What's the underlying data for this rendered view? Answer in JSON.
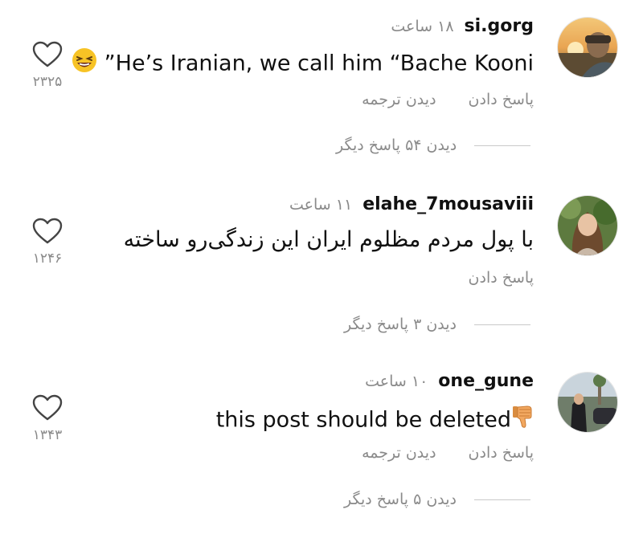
{
  "comments": [
    {
      "username": "si.gorg",
      "time": "۱۸ ساعت",
      "text_main": "”He’s Iranian, we call him “Bache Kooni",
      "emoji": "laughing-face",
      "actions": [
        "پاسخ دادن",
        "دیدن ترجمه"
      ],
      "view_replies": "دیدن ۵۴ پاسخ دیگر",
      "likes": "۲۳۲۵"
    },
    {
      "username": "elahe_7mousaviii",
      "time": "۱۱ ساعت",
      "text_main": "با پول مردم مظلوم ایران این زندگی‌رو ساخته",
      "actions": [
        "پاسخ دادن"
      ],
      "view_replies": "دیدن ۳ پاسخ دیگر",
      "likes": "۱۲۴۶"
    },
    {
      "username": "one_gune",
      "time": "۱۰ ساعت",
      "text_main": "this post should be deleted",
      "emoji": "thumbs-down",
      "actions": [
        "پاسخ دادن",
        "دیدن ترجمه"
      ],
      "view_replies": "دیدن ۵ پاسخ دیگر",
      "likes": "۱۳۴۳"
    }
  ],
  "colors": {
    "text": "#111111",
    "muted": "#8a8a8a",
    "divider": "#c9c9c9",
    "emoji_yellow": "#f7c325",
    "thumb_skin": "#f2a860"
  }
}
